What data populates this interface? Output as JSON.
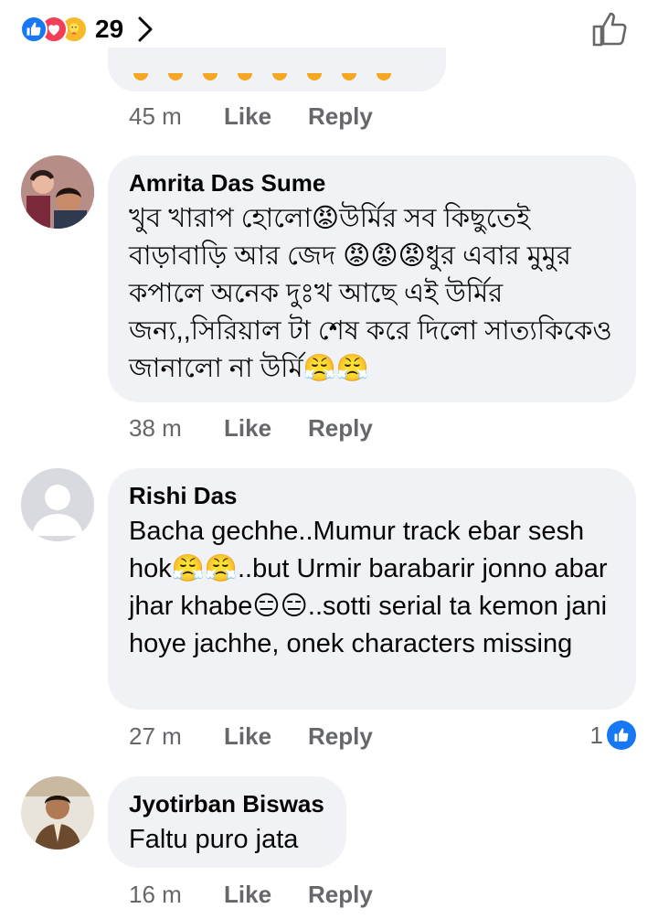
{
  "reactions_bar": {
    "icons": [
      "like-reaction-icon",
      "love-reaction-icon",
      "care-reaction-icon"
    ],
    "count": "29"
  },
  "previous_comment": {
    "time": "45 m",
    "like_label": "Like",
    "reply_label": "Reply"
  },
  "comments": [
    {
      "author": "Amrita Das Sume",
      "text": "খুব খারাপ হোলো😡উর্মির সব কিছুতেই বাড়াবাড়ি আর জেদ 😡😡😡ধুর এবার মুমুর কপালে অনেক দুঃখ আছে এই উর্মির জন্য,,সিরিয়াল টা শেষ করে দিলো সাত্যকিকেও জানালো না উর্মি😤😤",
      "time": "38 m",
      "like_label": "Like",
      "reply_label": "Reply"
    },
    {
      "author": "Rishi Das",
      "text": "Bacha gechhe..Mumur track ebar sesh hok😤😤..but Urmir barabarir jonno abar jhar khabe😑😑..sotti serial ta kemon jani hoye jachhe, onek characters missing",
      "time": "27 m",
      "like_label": "Like",
      "reply_label": "Reply",
      "like_count": "1"
    },
    {
      "author": "Jyotirban Biswas",
      "text": "Faltu puro jata",
      "time": "16 m",
      "like_label": "Like",
      "reply_label": "Reply"
    }
  ],
  "colors": {
    "bubble": "#f0f2f5",
    "meta_text": "#65676b",
    "facebook_blue": "#1877f2",
    "love_red": "#f33e58"
  }
}
